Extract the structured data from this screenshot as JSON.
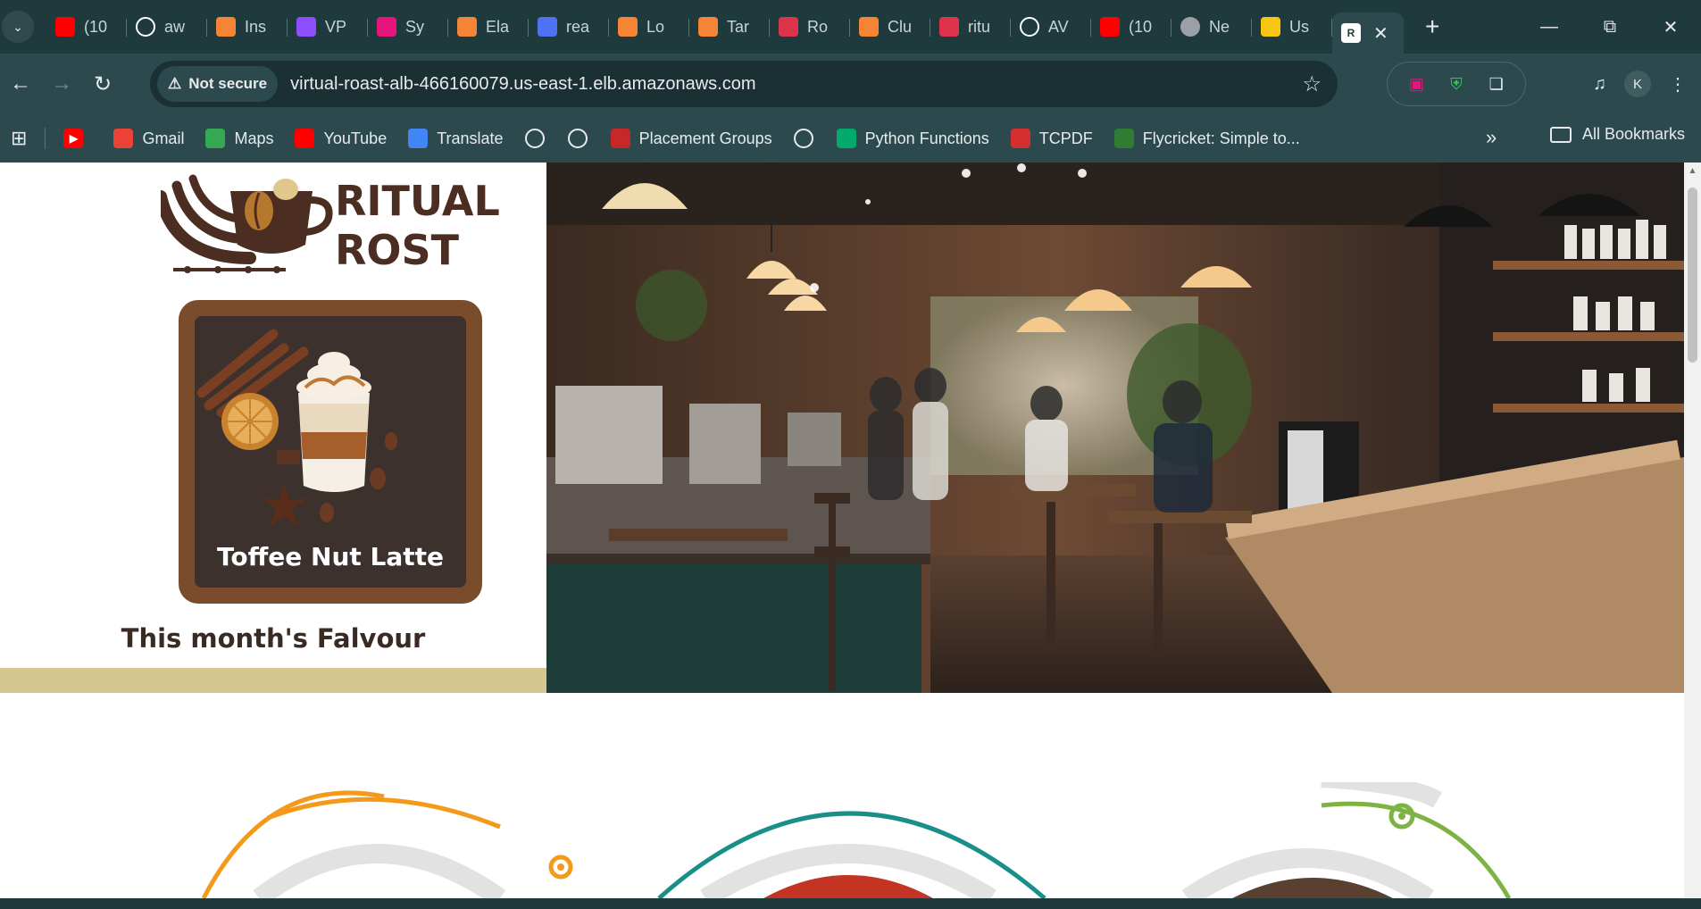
{
  "browser": {
    "tabs": [
      {
        "label": "(10",
        "icon": "youtube-icon",
        "color": "#ff0000"
      },
      {
        "label": "aw",
        "icon": "github-icon",
        "color": "#ffffff"
      },
      {
        "label": "Ins",
        "icon": "aws-ec2-icon",
        "color": "#f58536"
      },
      {
        "label": "VP",
        "icon": "aws-vpc-icon",
        "color": "#8c4fff"
      },
      {
        "label": "Sy",
        "icon": "aws-systems-manager-icon",
        "color": "#e7157b"
      },
      {
        "label": "Ela",
        "icon": "aws-elastic-icon",
        "color": "#f58536"
      },
      {
        "label": "rea",
        "icon": "aws-rekognition-icon",
        "color": "#4d72f3"
      },
      {
        "label": "Lo",
        "icon": "aws-load-balancer-icon",
        "color": "#f58536"
      },
      {
        "label": "Tar",
        "icon": "aws-target-group-icon",
        "color": "#f58536"
      },
      {
        "label": "Ro",
        "icon": "aws-route53-icon",
        "color": "#dd344c"
      },
      {
        "label": "Clu",
        "icon": "aws-cluster-icon",
        "color": "#f58536"
      },
      {
        "label": "ritu",
        "icon": "aws-settings-icon",
        "color": "#dd344c"
      },
      {
        "label": "AV",
        "icon": "github-icon",
        "color": "#ffffff"
      },
      {
        "label": "(10",
        "icon": "youtube-icon",
        "color": "#ff0000"
      },
      {
        "label": "Ne",
        "icon": "chrome-icon",
        "color": "#9aa0a6"
      },
      {
        "label": "Us",
        "icon": "aws-cube-icon",
        "color": "#f9c513"
      }
    ],
    "active_tab": {
      "icon_letter": "R",
      "icon": "ritual-roast-favicon"
    },
    "new_tab": "+",
    "address": {
      "security_label": "Not secure",
      "url": "virtual-roast-alb-466160079.us-east-1.elb.amazonaws.com"
    },
    "profile_initial": "K",
    "bookmarks": [
      {
        "label": "Gmail",
        "icon": "gmail-icon",
        "color": "#ea4335"
      },
      {
        "label": "Maps",
        "icon": "maps-icon",
        "color": "#34a853"
      },
      {
        "label": "YouTube",
        "icon": "youtube-icon",
        "color": "#ff0000"
      },
      {
        "label": "Translate",
        "icon": "translate-icon",
        "color": "#4285f4"
      },
      {
        "label": "",
        "icon": "globe-icon",
        "color": "#e8eaed"
      },
      {
        "label": "",
        "icon": "globe-icon",
        "color": "#e8eaed"
      },
      {
        "label": "Placement Groups",
        "icon": "placement-groups-icon",
        "color": "#c62828"
      },
      {
        "label": "",
        "icon": "globe-icon",
        "color": "#e8eaed"
      },
      {
        "label": "Python Functions",
        "icon": "w3schools-icon",
        "color": "#04aa6d"
      },
      {
        "label": "TCPDF",
        "icon": "pdf-icon",
        "color": "#d32f2f"
      },
      {
        "label": "Flycricket: Simple to...",
        "icon": "flycricket-icon",
        "color": "#2e7d32"
      }
    ],
    "all_bookmarks": "All Bookmarks"
  },
  "page": {
    "brand_line1": "RITUAL",
    "brand_line2": "ROST",
    "feature_title": "Toffee Nut Latte",
    "feature_caption": "This month's Falvour",
    "brand_color": "#4b2d22",
    "strip_color": "#d6c690"
  }
}
